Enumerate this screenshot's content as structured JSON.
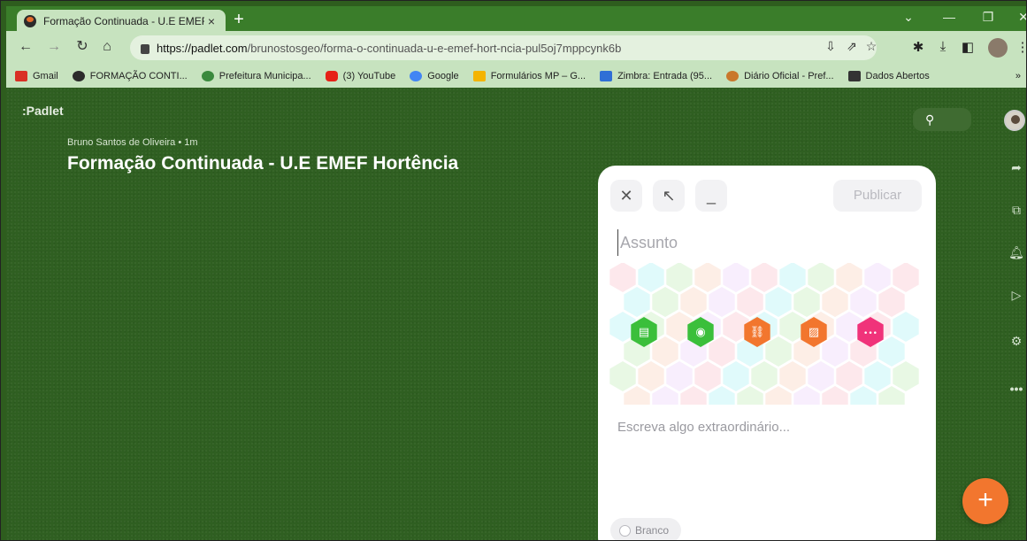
{
  "browser": {
    "tab_title": "Formação Continuada - U.E EMEF",
    "tab_close": "×",
    "new_tab": "+",
    "url_host": "https://padlet.com",
    "url_path": "/brunostosgeo/forma-o-continuada-u-e-emef-hort-ncia-pul5oj7mppcynk6b",
    "bookmarks": [
      {
        "label": "Gmail",
        "color": "#d93025"
      },
      {
        "label": "FORMAÇÃO CONTI...",
        "color": "#2b2b2b"
      },
      {
        "label": "Prefeitura Municipa...",
        "color": "#3b8a3e"
      },
      {
        "label": "(3) YouTube",
        "color": "#e62117"
      },
      {
        "label": "Google",
        "color": "#4285f4"
      },
      {
        "label": "Formulários MP – G...",
        "color": "#f4b400"
      },
      {
        "label": "Zimbra: Entrada (95...",
        "color": "#2f6fd6"
      },
      {
        "label": "Diário Oficial - Pref...",
        "color": "#c9772b"
      },
      {
        "label": "Dados Abertos",
        "color": "#333333"
      }
    ],
    "bookmarks_overflow": "»"
  },
  "padlet": {
    "logo": ":Padlet",
    "author": "Bruno Santos de Oliveira  • 1m",
    "title": "Formação Continuada - U.E EMEF Hortência"
  },
  "composer": {
    "publish_label": "Publicar",
    "subject_placeholder": "Assunto",
    "body_placeholder": "Escreva algo extraordinário...",
    "color_label": "Branco",
    "attachment_buttons": [
      {
        "name": "upload-file-icon",
        "color": "#3bbf3b"
      },
      {
        "name": "camera-icon",
        "color": "#3bbf3b"
      },
      {
        "name": "link-icon",
        "color": "#f2762e"
      },
      {
        "name": "image-search-icon",
        "color": "#f2762e"
      },
      {
        "name": "more-icon",
        "color": "#f0337a"
      }
    ]
  },
  "colors": {
    "accent": "#f2762e",
    "background": "#2f5f21"
  }
}
